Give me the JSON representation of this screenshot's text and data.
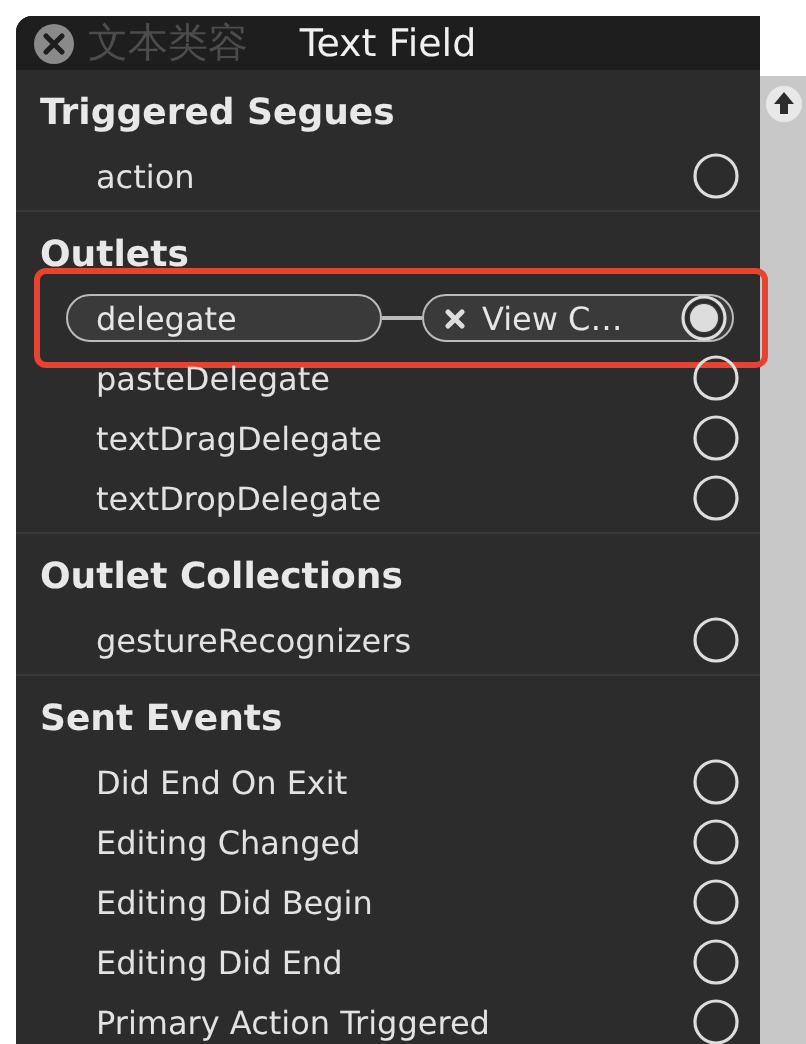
{
  "window": {
    "title": "Text Field",
    "backdrop_text": "文本类容"
  },
  "sections": [
    {
      "title": "Triggered Segues",
      "items": [
        {
          "label": "action",
          "connected": false
        }
      ]
    },
    {
      "title": "Outlets",
      "items": [
        {
          "label": "delegate",
          "connected": true,
          "kind": "connection",
          "target": "View C…",
          "highlighted": true
        },
        {
          "label": "pasteDelegate",
          "connected": false
        },
        {
          "label": "textDragDelegate",
          "connected": false
        },
        {
          "label": "textDropDelegate",
          "connected": false
        }
      ]
    },
    {
      "title": "Outlet Collections",
      "items": [
        {
          "label": "gestureRecognizers",
          "connected": false
        }
      ]
    },
    {
      "title": "Sent Events",
      "items": [
        {
          "label": "Did End On Exit",
          "connected": false
        },
        {
          "label": "Editing Changed",
          "connected": false
        },
        {
          "label": "Editing Did Begin",
          "connected": false
        },
        {
          "label": "Editing Did End",
          "connected": false
        },
        {
          "label": "Primary Action Triggered",
          "connected": false
        }
      ]
    }
  ]
}
